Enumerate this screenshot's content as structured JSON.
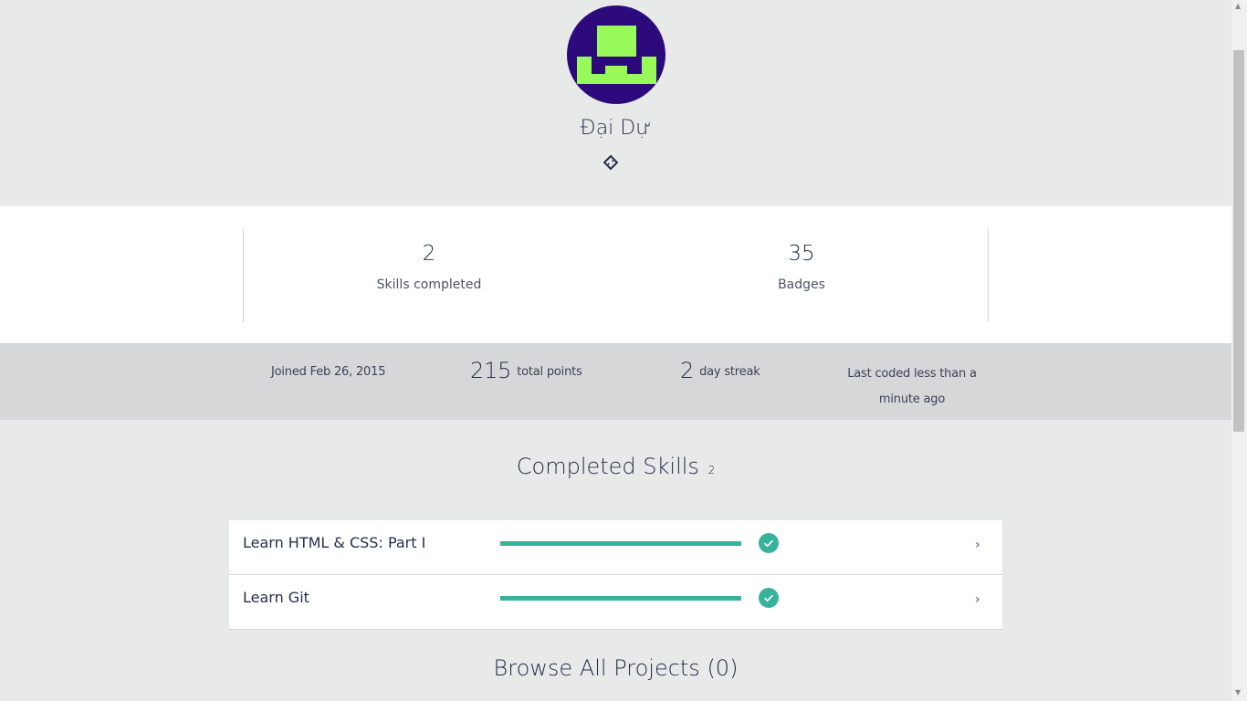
{
  "profile": {
    "username": "Đại Dự",
    "avatar_icon": "pixel-robot-avatar",
    "share_icon": "share-link-icon"
  },
  "stats": {
    "skills_completed": {
      "value": "2",
      "label": "Skills completed"
    },
    "badges": {
      "value": "35",
      "label": "Badges"
    }
  },
  "meta": {
    "joined": "Joined Feb 26, 2015",
    "points_value": "215",
    "points_label": "total points",
    "streak_value": "2",
    "streak_label": "day streak",
    "last_coded": "Last coded less than a minute ago"
  },
  "completed_skills": {
    "title": "Completed Skills",
    "count": "2",
    "items": [
      {
        "name": "Learn HTML & CSS: Part I",
        "progress": 1.0,
        "status_icon": "check-icon",
        "chevron": "›"
      },
      {
        "name": "Learn Git",
        "progress": 1.0,
        "status_icon": "check-icon",
        "chevron": "›"
      }
    ]
  },
  "browse_projects": {
    "title": "Browse All Projects (0)"
  },
  "colors": {
    "accent": "#36b39a",
    "avatar_bg": "#2d0a7c",
    "avatar_fg": "#98f95a",
    "text": "#23304a"
  }
}
